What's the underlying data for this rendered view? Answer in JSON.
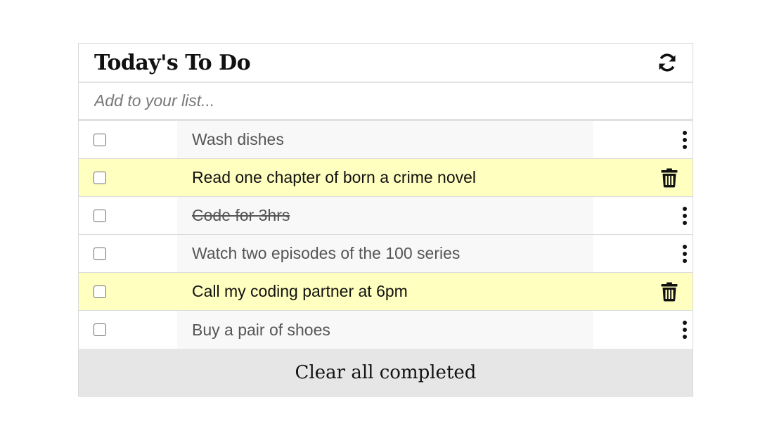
{
  "header": {
    "title": "Today's To Do",
    "refresh_icon": "refresh-icon"
  },
  "add_input": {
    "placeholder": "Add to your list...",
    "value": ""
  },
  "todos": [
    {
      "text": "Wash dishes",
      "completed": false,
      "highlighted": false,
      "action_icon": "kebab-menu-icon"
    },
    {
      "text": "Read one chapter of born a crime novel",
      "completed": false,
      "highlighted": true,
      "action_icon": "trash-icon"
    },
    {
      "text": "Code for 3hrs",
      "completed": true,
      "highlighted": false,
      "action_icon": "kebab-menu-icon"
    },
    {
      "text": "Watch two episodes of the 100 series",
      "completed": false,
      "highlighted": false,
      "action_icon": "kebab-menu-icon"
    },
    {
      "text": "Call my coding partner at 6pm",
      "completed": false,
      "highlighted": true,
      "action_icon": "trash-icon"
    },
    {
      "text": "Buy a pair of shoes",
      "completed": false,
      "highlighted": false,
      "action_icon": "kebab-menu-icon"
    }
  ],
  "footer": {
    "clear_label": "Clear all completed"
  },
  "colors": {
    "highlight": "#ffffbf",
    "footer_bg": "#e6e6e6",
    "item_text_bg": "#f8f8f8"
  }
}
